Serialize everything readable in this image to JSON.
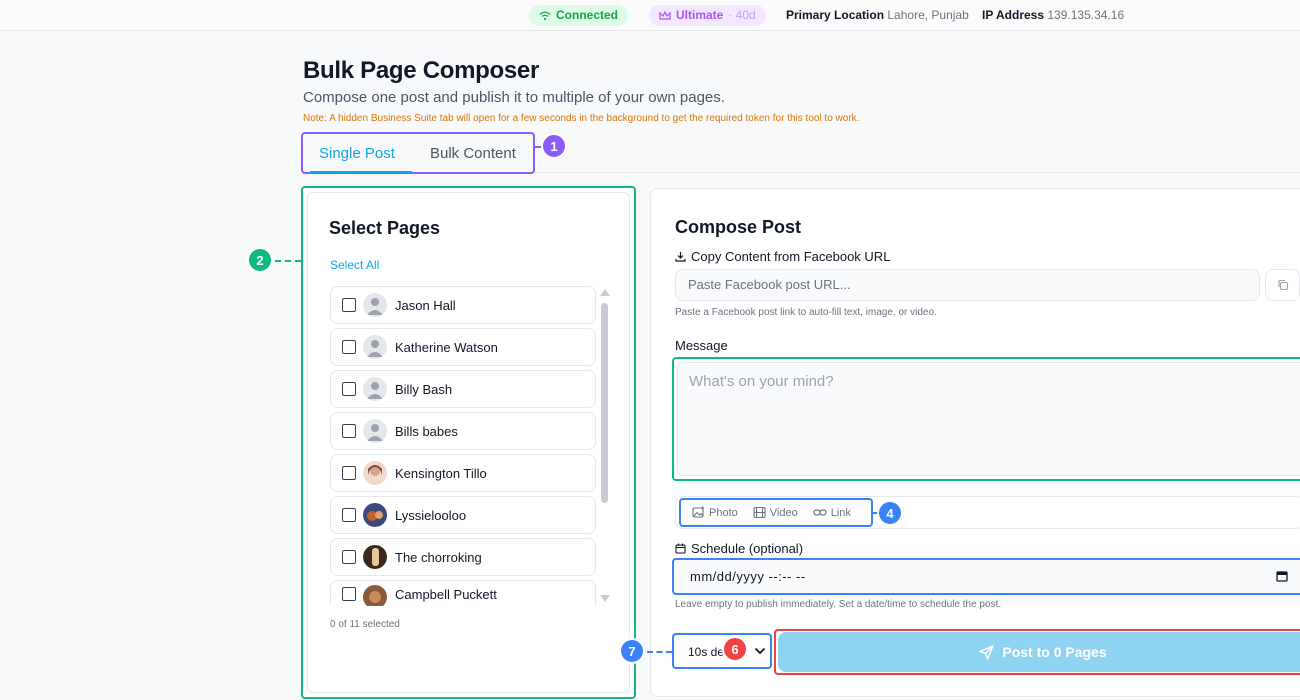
{
  "topbar": {
    "status": "Connected",
    "plan": "Ultimate",
    "plan_days": "· 40d",
    "location_label": "Primary Location",
    "location_value": "Lahore, Punjab",
    "ip_label": "IP Address",
    "ip_value": "139.135.34.16"
  },
  "header": {
    "title": "Bulk Page Composer",
    "subtitle": "Compose one post and publish it to multiple of your own pages.",
    "note": "Note: A hidden Business Suite tab will open for a few seconds in the background to get the required token for this tool to work."
  },
  "tabs": [
    {
      "label": "Single Post",
      "active": true
    },
    {
      "label": "Bulk Content",
      "active": false
    }
  ],
  "badges": {
    "tabs": "1",
    "pages": "2",
    "attachments": "4",
    "post": "6",
    "delay": "7"
  },
  "pages_panel": {
    "title": "Select Pages",
    "select_all": "Select All",
    "pages": [
      {
        "name": "Jason Hall",
        "avatar": "default"
      },
      {
        "name": "Katherine Watson",
        "avatar": "default"
      },
      {
        "name": "Billy Bash",
        "avatar": "default"
      },
      {
        "name": "Bills babes",
        "avatar": "default"
      },
      {
        "name": "Kensington Tillo",
        "avatar": "photo"
      },
      {
        "name": "Lyssielooloo",
        "avatar": "photo"
      },
      {
        "name": "The chorroking",
        "avatar": "photo"
      },
      {
        "name": "Campbell Puckett",
        "avatar": "photo"
      }
    ],
    "selected_count": "0 of 11 selected"
  },
  "compose": {
    "title": "Compose Post",
    "copy_label": "Copy Content from Facebook URL",
    "url_placeholder": "Paste Facebook post URL...",
    "url_hint": "Paste a Facebook post link to auto-fill text, image, or video.",
    "message_label": "Message",
    "message_placeholder": "What's on your mind?",
    "attach": {
      "photo": "Photo",
      "video": "Video",
      "link": "Link"
    },
    "schedule_label": "Schedule (optional)",
    "schedule_value": "mm/dd/yyyy --:-- --",
    "schedule_hint": "Leave empty to publish immediately. Set a date/time to schedule the post.",
    "delay_value": "10s de",
    "post_button": "Post to 0 Pages"
  },
  "colors": {
    "accent": "#0ea5e9",
    "connected": "#16a34a",
    "plan": "#a855f7",
    "note": "#d97706",
    "post_button": "#8ed3f2"
  }
}
